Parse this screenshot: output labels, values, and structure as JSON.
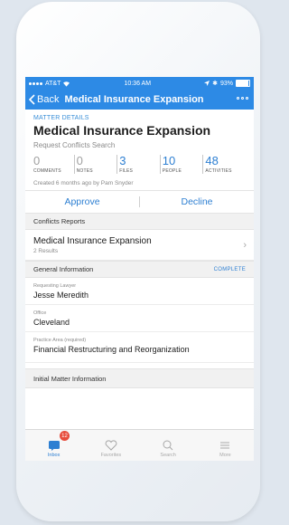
{
  "status_bar": {
    "carrier": "AT&T",
    "time": "10:36 AM",
    "battery": "93%",
    "battery_level": 0.93
  },
  "nav": {
    "back_label": "Back",
    "title": "Medical Insurance Expansion"
  },
  "matter": {
    "section_label": "MATTER DETAILS",
    "title": "Medical Insurance Expansion",
    "subtitle": "Request Conflicts Search",
    "stats": [
      {
        "value": "0",
        "label": "COMMENTS"
      },
      {
        "value": "0",
        "label": "NOTES"
      },
      {
        "value": "3",
        "label": "FILES"
      },
      {
        "value": "10",
        "label": "PEOPLE"
      },
      {
        "value": "48",
        "label": "ACTIVITIES"
      }
    ],
    "created": "Created 6 months ago by Pam Snyder"
  },
  "actions": {
    "approve": "Approve",
    "decline": "Decline"
  },
  "conflicts": {
    "header": "Conflicts Reports",
    "report_name": "Medical Insurance Expansion",
    "report_results": "2 Results"
  },
  "general": {
    "header": "General Information",
    "status": "COMPLETE",
    "fields": [
      {
        "label": "Requesting Lawyer",
        "value": "Jesse Meredith"
      },
      {
        "label": "Office",
        "value": "Cleveland"
      },
      {
        "label": "Practice Area (required)",
        "value": "Financial Restructuring and Reorganization"
      }
    ]
  },
  "initial": {
    "header": "Initial Matter Information"
  },
  "tabbar": {
    "tabs": [
      {
        "label": "Inbox"
      },
      {
        "label": "Favorites"
      },
      {
        "label": "Search"
      },
      {
        "label": "More"
      }
    ],
    "inbox_badge": "12"
  },
  "colors": {
    "accent": "#2d8ae5",
    "badge": "#e74c3c"
  }
}
